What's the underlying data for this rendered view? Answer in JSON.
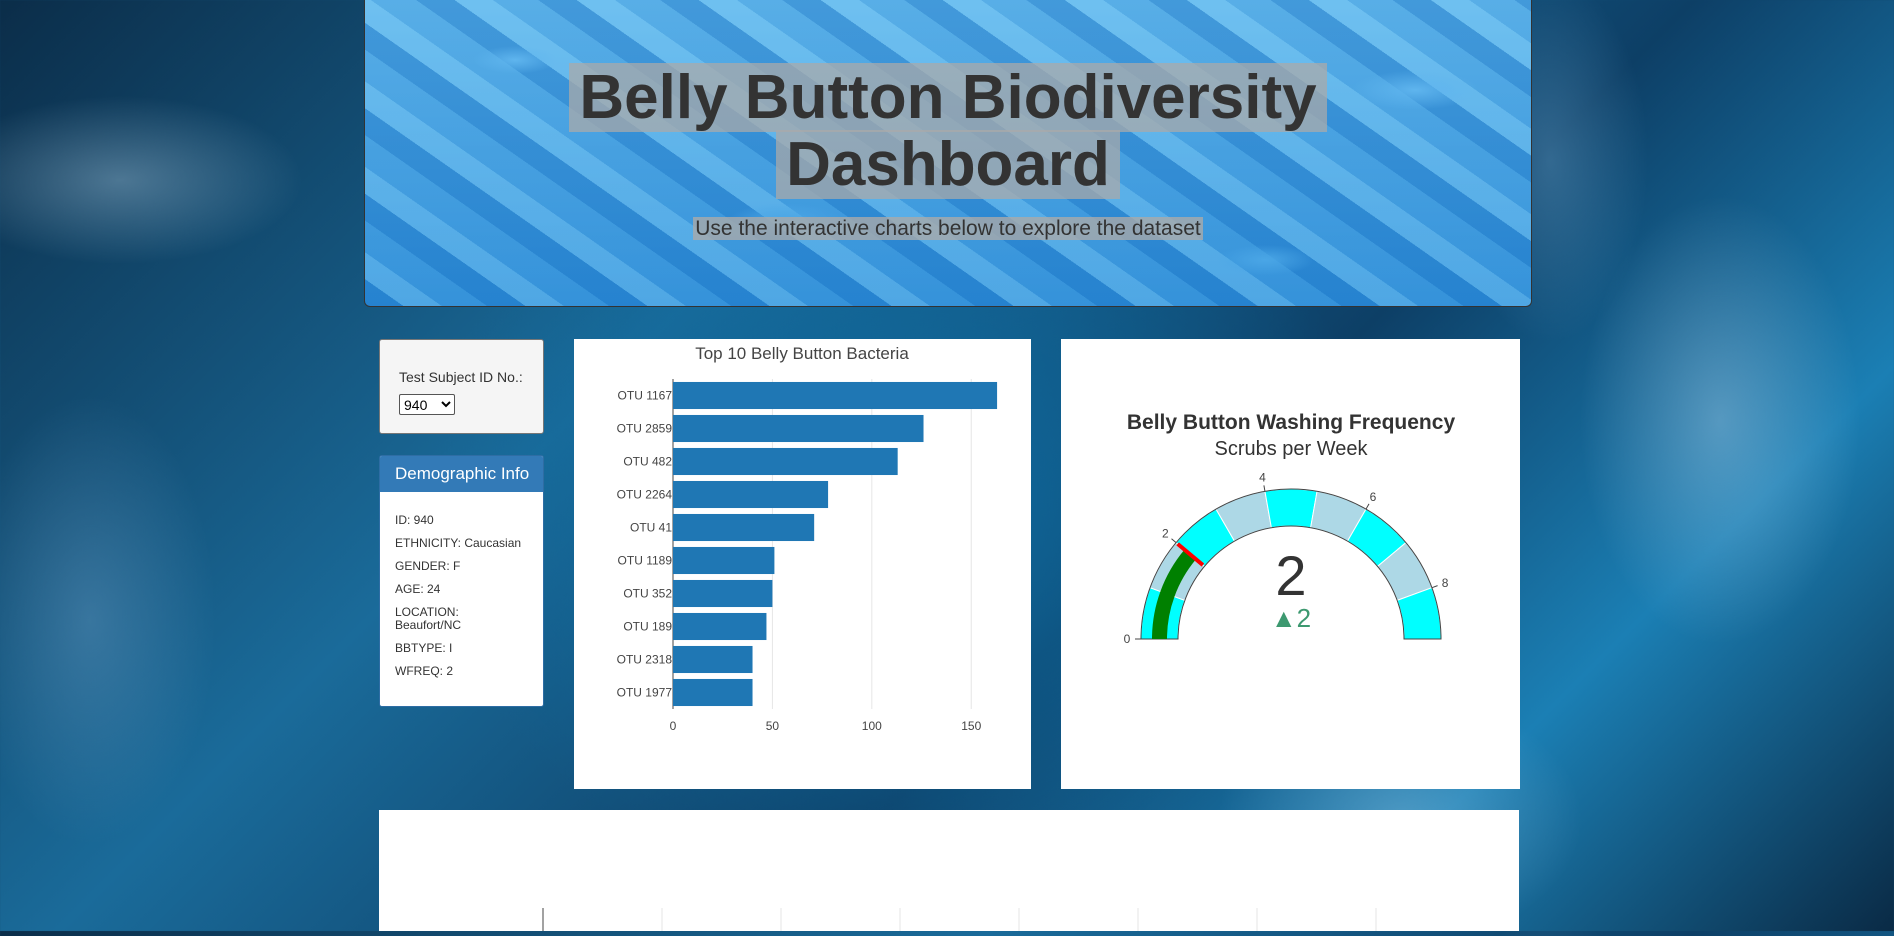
{
  "header": {
    "title_line1": "Belly Button Biodiversity",
    "title_line2": "Dashboard",
    "subtitle": "Use the interactive charts below to explore the dataset"
  },
  "selector": {
    "label": "Test Subject ID No.:",
    "selected": "940"
  },
  "demographics": {
    "heading": "Demographic Info",
    "lines": [
      "ID: 940",
      "ETHNICITY: Caucasian",
      "GENDER: F",
      "AGE: 24",
      "LOCATION: Beaufort/NC",
      "BBTYPE: I",
      "WFREQ: 2"
    ]
  },
  "chart_data": [
    {
      "type": "bar",
      "orientation": "horizontal",
      "title": "Top 10 Belly Button Bacteria",
      "categories": [
        "OTU 1167",
        "OTU 2859",
        "OTU 482",
        "OTU 2264",
        "OTU 41",
        "OTU 1189",
        "OTU 352",
        "OTU 189",
        "OTU 2318",
        "OTU 1977"
      ],
      "values": [
        163,
        126,
        113,
        78,
        71,
        51,
        50,
        47,
        40,
        40
      ],
      "xlim": [
        0,
        170
      ],
      "xticks": [
        0,
        50,
        100,
        150
      ],
      "color": "#1f77b4",
      "grid": true
    },
    {
      "type": "gauge",
      "title": "Belly Button Washing Frequency",
      "subtitle": "Scrubs per Week",
      "value": 2,
      "delta": "▲2",
      "range": [
        0,
        9
      ],
      "ticks": [
        0,
        2,
        4,
        6,
        8
      ],
      "steps": [
        {
          "range": [
            0,
            1
          ],
          "color": "#00ffff"
        },
        {
          "range": [
            1,
            2
          ],
          "color": "#add8e6"
        },
        {
          "range": [
            2,
            3
          ],
          "color": "#00ffff"
        },
        {
          "range": [
            3,
            4
          ],
          "color": "#add8e6"
        },
        {
          "range": [
            4,
            5
          ],
          "color": "#00ffff"
        },
        {
          "range": [
            5,
            6
          ],
          "color": "#add8e6"
        },
        {
          "range": [
            6,
            7
          ],
          "color": "#00ffff"
        },
        {
          "range": [
            7,
            8
          ],
          "color": "#add8e6"
        },
        {
          "range": [
            8,
            9
          ],
          "color": "#00ffff"
        }
      ],
      "bar_color": "#008000",
      "threshold_color": "#ff0000",
      "number_color": "#333333",
      "delta_color": "#3d9970"
    }
  ]
}
